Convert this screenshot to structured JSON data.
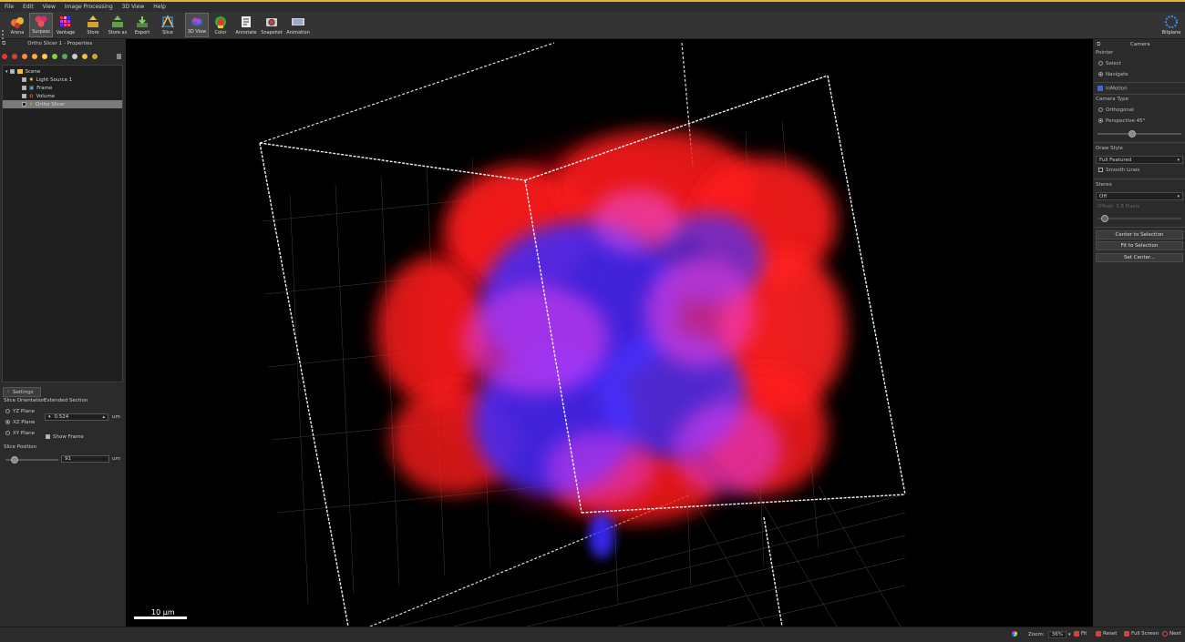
{
  "menu": [
    "File",
    "Edit",
    "View",
    "Image Processing",
    "3D View",
    "Help"
  ],
  "toolbar": {
    "items": [
      {
        "label": "Arena",
        "icon": "arena-icon"
      },
      {
        "label": "Surpass",
        "icon": "surpass-icon",
        "active": true
      },
      {
        "label": "Vantage",
        "icon": "vantage-icon"
      },
      {
        "label": "Store",
        "icon": "store-icon"
      },
      {
        "label": "Store as",
        "icon": "store-as-icon"
      },
      {
        "label": "Export",
        "icon": "export-icon"
      },
      {
        "label": "Slice",
        "icon": "slice-icon"
      },
      {
        "label": "3D View",
        "icon": "3d-view-icon",
        "active": true
      },
      {
        "label": "Color",
        "icon": "color-icon"
      },
      {
        "label": "Annotate",
        "icon": "annotate-icon"
      },
      {
        "label": "Snapshot",
        "icon": "snapshot-icon"
      },
      {
        "label": "Animation",
        "icon": "animation-icon"
      }
    ],
    "right_label": "Bitplane"
  },
  "left_panel": {
    "title": "Ortho Slicer 1 - Properties",
    "tree": [
      {
        "label": "Scene",
        "checked": true,
        "level": 0
      },
      {
        "label": "Light Source 1",
        "checked": true,
        "level": 1
      },
      {
        "label": "Frame",
        "checked": true,
        "level": 1
      },
      {
        "label": "Volume",
        "checked": true,
        "level": 1
      },
      {
        "label": "Ortho Slicer",
        "checked": false,
        "level": 1,
        "selected": true
      }
    ],
    "settings_tab": "Settings",
    "slice_orientation_label": "Slice Orientation",
    "extended_section_label": "Extended Section",
    "planes": [
      {
        "label": "YZ Plane",
        "selected": false
      },
      {
        "label": "XZ Plane",
        "selected": true
      },
      {
        "label": "XY Plane",
        "selected": false
      }
    ],
    "extended_value": "0.524",
    "extended_unit": "um",
    "show_frame_label": "Show Frame",
    "slice_position_label": "Slice Position",
    "slice_position_value": "91",
    "slice_position_unit": "um",
    "slice_position_fraction": 0.15
  },
  "viewport": {
    "scale_bar_label": "10 µm"
  },
  "right_panel": {
    "title": "Camera",
    "pointer_label": "Pointer",
    "pointer_options": [
      {
        "label": "Select",
        "selected": false
      },
      {
        "label": "Navigate",
        "selected": true
      }
    ],
    "inmotion_label": "InMotion",
    "camera_type_label": "Camera Type",
    "camera_options": [
      {
        "label": "Orthogonal",
        "selected": false
      },
      {
        "label": "Perspective 45°",
        "selected": true
      }
    ],
    "perspective_fraction": 0.4,
    "draw_style_label": "Draw Style",
    "draw_style_value": "Full Featured",
    "smooth_lines_label": "Smooth Lines",
    "stereo_label": "Stereo",
    "stereo_value": "Off",
    "offset_label": "Offset: 3.8 Pixels",
    "buttons": [
      "Center to Selection",
      "Fit to Selection",
      "Set Center..."
    ]
  },
  "statusbar": {
    "zoom_label": "Zoom:",
    "zoom_value": "36%",
    "fit_label": "Fit",
    "reset_label": "Reset",
    "fullscreen_label": "Full Screen",
    "next_label": "Next"
  },
  "colors": {
    "accent": "#e4b43c",
    "red_channel": "#ff1a1a",
    "blue_channel": "#3a2cff",
    "magenta_mix": "#e23cf0"
  }
}
